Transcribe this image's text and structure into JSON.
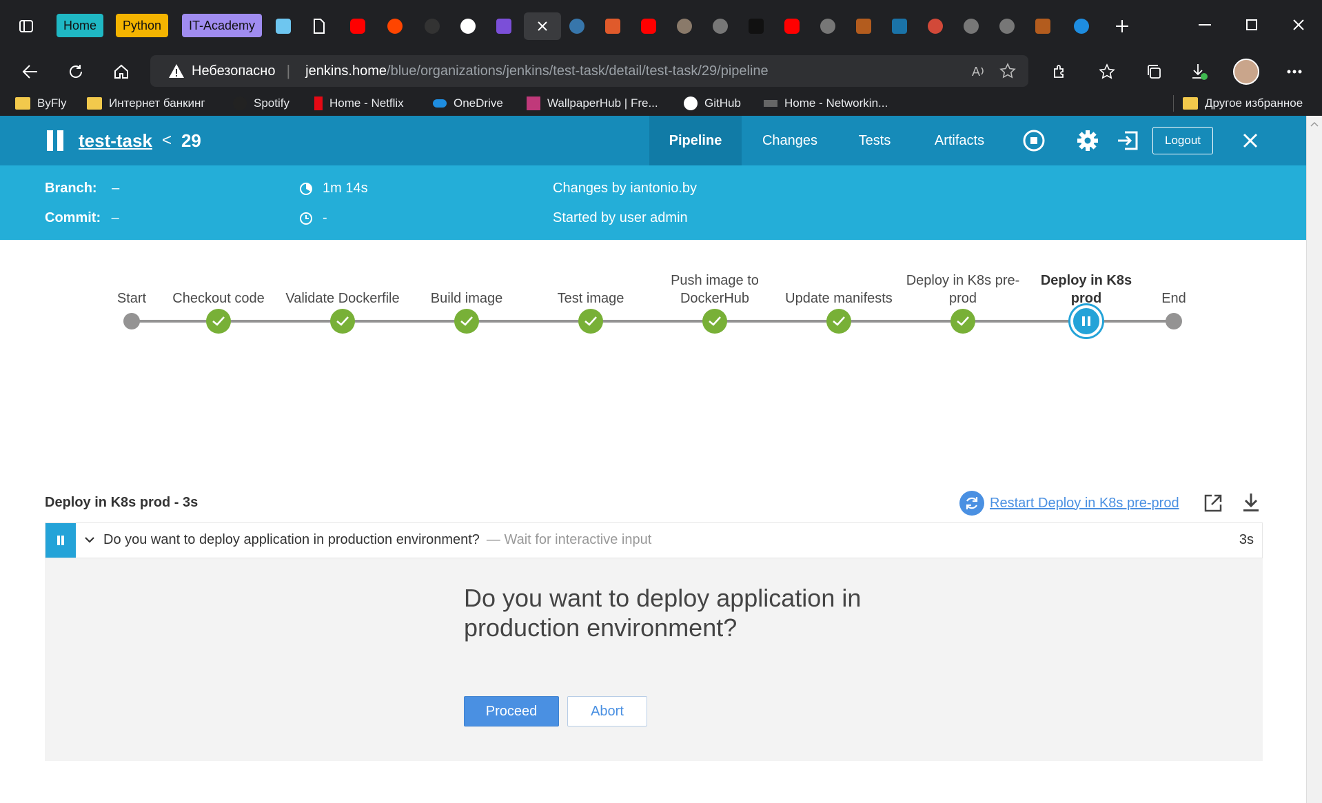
{
  "browser": {
    "tab_groups": [
      {
        "label": "Home",
        "color": "#1fb8c4"
      },
      {
        "label": "Python",
        "color": "#f4b400"
      },
      {
        "label": "IT-Academy",
        "color": "#a08cf0"
      }
    ],
    "security_label": "Небезопасно",
    "url_host": "jenkins.home",
    "url_path": "/blue/organizations/jenkins/test-task/detail/test-task/29/pipeline",
    "bookmarks": [
      "ByFly",
      "Интернет банкинг",
      "Spotify",
      "Home - Netflix",
      "OneDrive",
      "WallpaperHub | Fre...",
      "GitHub",
      "Home - Networkin...",
      "Другое избранное"
    ]
  },
  "header": {
    "job_name": "test-task",
    "separator": "<",
    "run_number": "29",
    "nav": [
      "Pipeline",
      "Changes",
      "Tests",
      "Artifacts"
    ],
    "active_nav": "Pipeline",
    "logout": "Logout"
  },
  "run_info": {
    "branch_label": "Branch:",
    "branch_value": "–",
    "commit_label": "Commit:",
    "commit_value": "–",
    "duration": "1m 14s",
    "time_ago": "-",
    "changes": "Changes by iantonio.by",
    "started": "Started by user admin"
  },
  "pipeline": {
    "start": "Start",
    "end": "End",
    "stages": [
      {
        "name": "Checkout code",
        "status": "success"
      },
      {
        "name": "Validate Dockerfile",
        "status": "success"
      },
      {
        "name": "Build image",
        "status": "success"
      },
      {
        "name": "Test image",
        "status": "success"
      },
      {
        "name": "Push image to DockerHub",
        "status": "success"
      },
      {
        "name": "Update manifests",
        "status": "success"
      },
      {
        "name": "Deploy in K8s pre-prod",
        "status": "success"
      },
      {
        "name": "Deploy in K8s prod",
        "status": "paused"
      }
    ]
  },
  "step_panel": {
    "title": "Deploy in K8s prod - 3s",
    "restart_link": "Restart Deploy in K8s pre-prod",
    "step_message": "Do you want to deploy application in production environment?",
    "step_desc": "— Wait for interactive input",
    "step_duration": "3s",
    "input_message": "Do you want to deploy application in production environment?",
    "proceed": "Proceed",
    "abort": "Abort"
  },
  "colors": {
    "header_bg": "#168bb9",
    "subheader_bg": "#24aed8",
    "success": "#78b037",
    "paused": "#24a3d8",
    "link": "#4a90e2"
  }
}
